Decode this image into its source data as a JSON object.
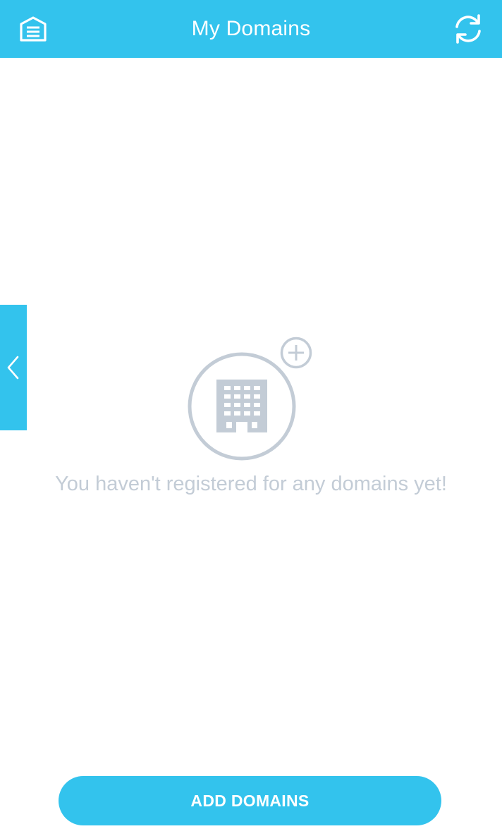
{
  "header": {
    "title": "My Domains",
    "menu_icon": "home-menu-icon",
    "refresh_icon": "refresh-icon"
  },
  "side_tab": {
    "icon": "chevron-left-icon"
  },
  "empty_state": {
    "icon": "building-add-icon",
    "message": "You haven't registered for any domains yet!"
  },
  "actions": {
    "add_domains_label": "ADD DOMAINS"
  },
  "colors": {
    "primary": "#33c3ed",
    "muted": "#c3ccd6",
    "background": "#ffffff"
  }
}
